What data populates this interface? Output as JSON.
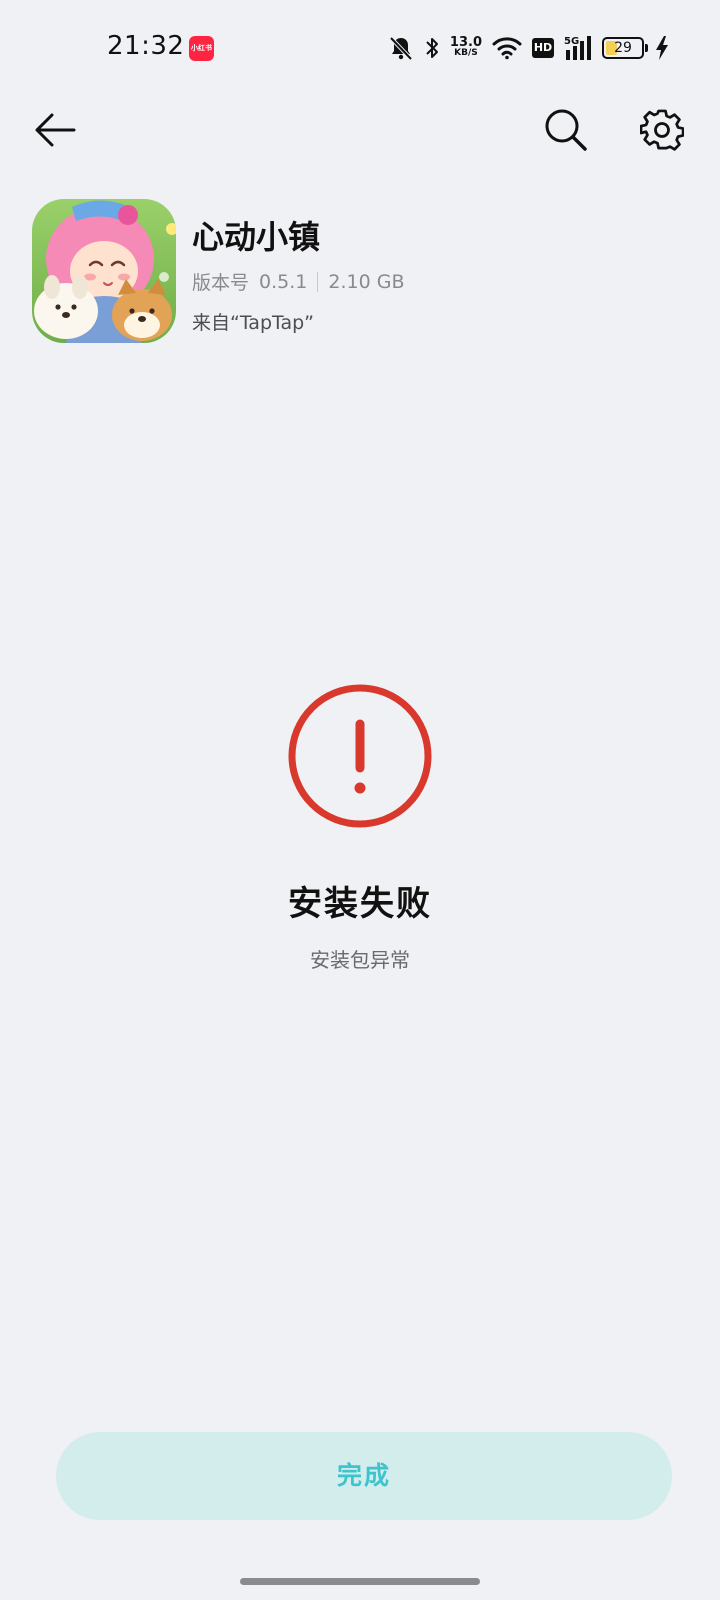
{
  "status_bar": {
    "time": "21:32",
    "notification_app": "小红书",
    "net_speed_value": "13.0",
    "net_speed_unit": "KB/S",
    "hd": "HD",
    "signal": "5G",
    "battery_level": "29",
    "battery_fraction": 0.29,
    "battery_color": "#f4cf58"
  },
  "toolbar": {
    "back_icon": "arrow-left-icon",
    "search_icon": "search-icon",
    "settings_icon": "gear-icon"
  },
  "app": {
    "name": "心动小镇",
    "version_label": "版本号",
    "version": "0.5.1",
    "size": "2.10 GB",
    "source": "来自“TapTap”"
  },
  "result": {
    "status_icon": "exclamation-circle-icon",
    "status_color": "#d9382c",
    "title": "安装失败",
    "subtitle": "安装包异常"
  },
  "actions": {
    "done_label": "完成",
    "done_color": "#3dc4cc"
  }
}
